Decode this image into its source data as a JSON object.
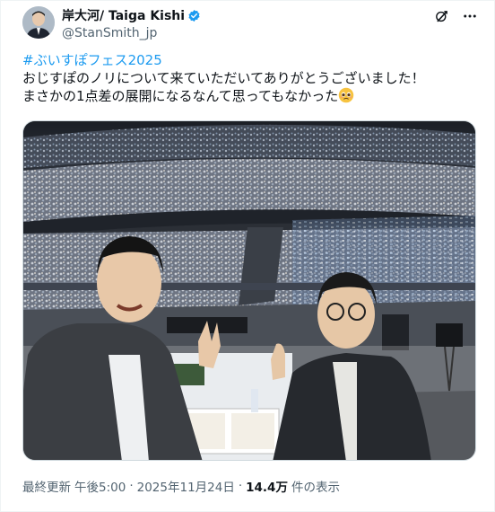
{
  "author": {
    "display_name": "岸大河/ Taiga Kishi",
    "handle": "@StanSmith_jp",
    "verified": true
  },
  "tweet": {
    "hashtag": "#ぶいすぽフェス2025",
    "line1": "おじすぽのノリについて来ていただいてありがとうございました！",
    "line2": "まさかの1点差の展開になるなんて思ってもなかった",
    "emoji": "pleading-face-emoji"
  },
  "meta": {
    "updated_label": "最終更新",
    "time": "午後5:00",
    "date": "2025年11月24日",
    "views_count": "14.4万",
    "views_label": "件の表示"
  },
  "colors": {
    "link": "#1d9bf0",
    "verified": "#1d9bf0",
    "secondary_text": "#536471"
  },
  "icons": {
    "verified": "verified-badge-icon",
    "grok": "grok-icon",
    "more": "more-options-icon"
  }
}
